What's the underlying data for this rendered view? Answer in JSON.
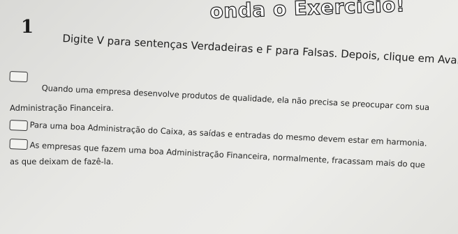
{
  "title": "onda o Exercício!",
  "question_number": "1",
  "instruction": "Digite V para sentenças Verdadeiras e F para Falsas. Depois, clique em Avançar.",
  "statements": [
    {
      "line1": "Quando uma empresa desenvolve produtos de qualidade, ela não precisa se preocupar com sua",
      "line2": "Administração Financeira."
    },
    {
      "line1": "Para uma boa Administração do Caixa, as saídas e entradas do mesmo devem estar em harmonia."
    },
    {
      "line1": "As empresas que fazem uma boa Administração Financeira, normalmente, fracassam mais do que",
      "line2": "as que deixam de fazê-la."
    }
  ]
}
